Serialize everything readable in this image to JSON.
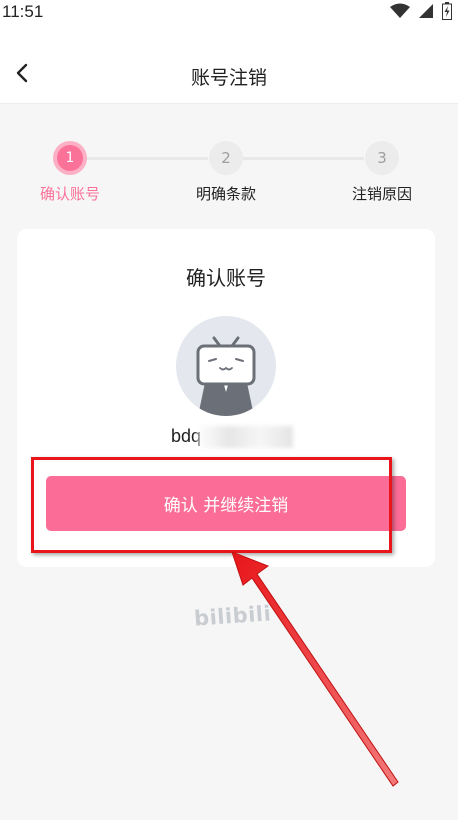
{
  "status_bar": {
    "time": "11:51",
    "icons": [
      "wifi-icon",
      "signal-icon",
      "battery-icon"
    ]
  },
  "nav": {
    "title": "账号注销",
    "back_icon": "chevron-left-icon"
  },
  "stepper": {
    "steps": [
      {
        "number": "1",
        "label": "确认账号",
        "state": "active"
      },
      {
        "number": "2",
        "label": "明确条款",
        "state": "inactive"
      },
      {
        "number": "3",
        "label": "注销原因",
        "state": "inactive"
      }
    ]
  },
  "card": {
    "title": "确认账号",
    "avatar_icon": "tv-mascot-avatar-icon",
    "username": "bdq",
    "confirm_button": "确认 并继续注销"
  },
  "footer": {
    "logo": "bilibili"
  },
  "colors": {
    "accent": "#fb7299",
    "button": "#fb6d96",
    "annotation": "#e8161a"
  }
}
